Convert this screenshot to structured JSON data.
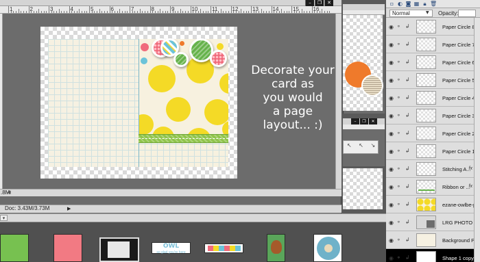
{
  "document": {
    "zoom": ".8M",
    "doc_size": "Doc: 3.43M/3.73M",
    "ruler_numbers": [
      "1",
      "2",
      "3",
      "4",
      "5",
      "6",
      "7",
      "8",
      "9",
      "10",
      "11",
      "12",
      "13",
      "14",
      "15",
      "16"
    ],
    "overlay_text": "Decorate your\ncard as\nyou would\na page\nlayout... :)",
    "win_buttons": [
      "–",
      "❐",
      "✕"
    ],
    "status_arrow": "▶",
    "scroll_left": "◀"
  },
  "secondary_window": {
    "buttons": [
      "–",
      "❐",
      "✕"
    ],
    "arrows": "↖ ↖ ↘"
  },
  "layers_panel": {
    "blend_mode": "Normal",
    "opacity_label": "Opacity:",
    "toolbar_icons": [
      "new-layer",
      "fill-adjust",
      "mask",
      "lock-transparent",
      "lock-all",
      "delete"
    ],
    "layers": [
      {
        "name": "Paper Circle 8",
        "fx": false,
        "selected": false,
        "thumb": "transparent"
      },
      {
        "name": "Paper Circle 7",
        "fx": false,
        "selected": false,
        "thumb": "transparent"
      },
      {
        "name": "Paper Circle 6",
        "fx": false,
        "selected": false,
        "thumb": "transparent"
      },
      {
        "name": "Paper Circle 5",
        "fx": false,
        "selected": false,
        "thumb": "transparent"
      },
      {
        "name": "Paper Circle 4",
        "fx": false,
        "selected": false,
        "thumb": "transparent"
      },
      {
        "name": "Paper Circle 3",
        "fx": false,
        "selected": false,
        "thumb": "transparent"
      },
      {
        "name": "Paper Circle 2",
        "fx": false,
        "selected": false,
        "thumb": "transparent"
      },
      {
        "name": "Paper Circle 1",
        "fx": false,
        "selected": false,
        "thumb": "transparent"
      },
      {
        "name": "Stitching A...",
        "fx": true,
        "selected": false,
        "thumb": "transparent"
      },
      {
        "name": "Ribbon or ...",
        "fx": true,
        "selected": false,
        "thumb": "green-line"
      },
      {
        "name": "ezane-owlbe-p...",
        "fx": false,
        "selected": false,
        "thumb": "yellow-dots"
      },
      {
        "name": "LRG PHOTO 3",
        "fx": false,
        "selected": false,
        "thumb": "gray-photo"
      },
      {
        "name": "Background Pa...",
        "fx": false,
        "selected": false,
        "thumb": "cream"
      },
      {
        "name": "Shape 1 copy",
        "fx": false,
        "selected": true,
        "thumb": "white"
      }
    ]
  },
  "project_bin": {
    "dropdown_label": "▾",
    "owl_text": "OWL",
    "owl_subtext": "so glad you're here"
  },
  "colors": {
    "accent_yellow": "#f4da26",
    "ribbon_green": "#8fc44a",
    "orange": "#ef7a2b",
    "pink": "#f06b7c"
  }
}
